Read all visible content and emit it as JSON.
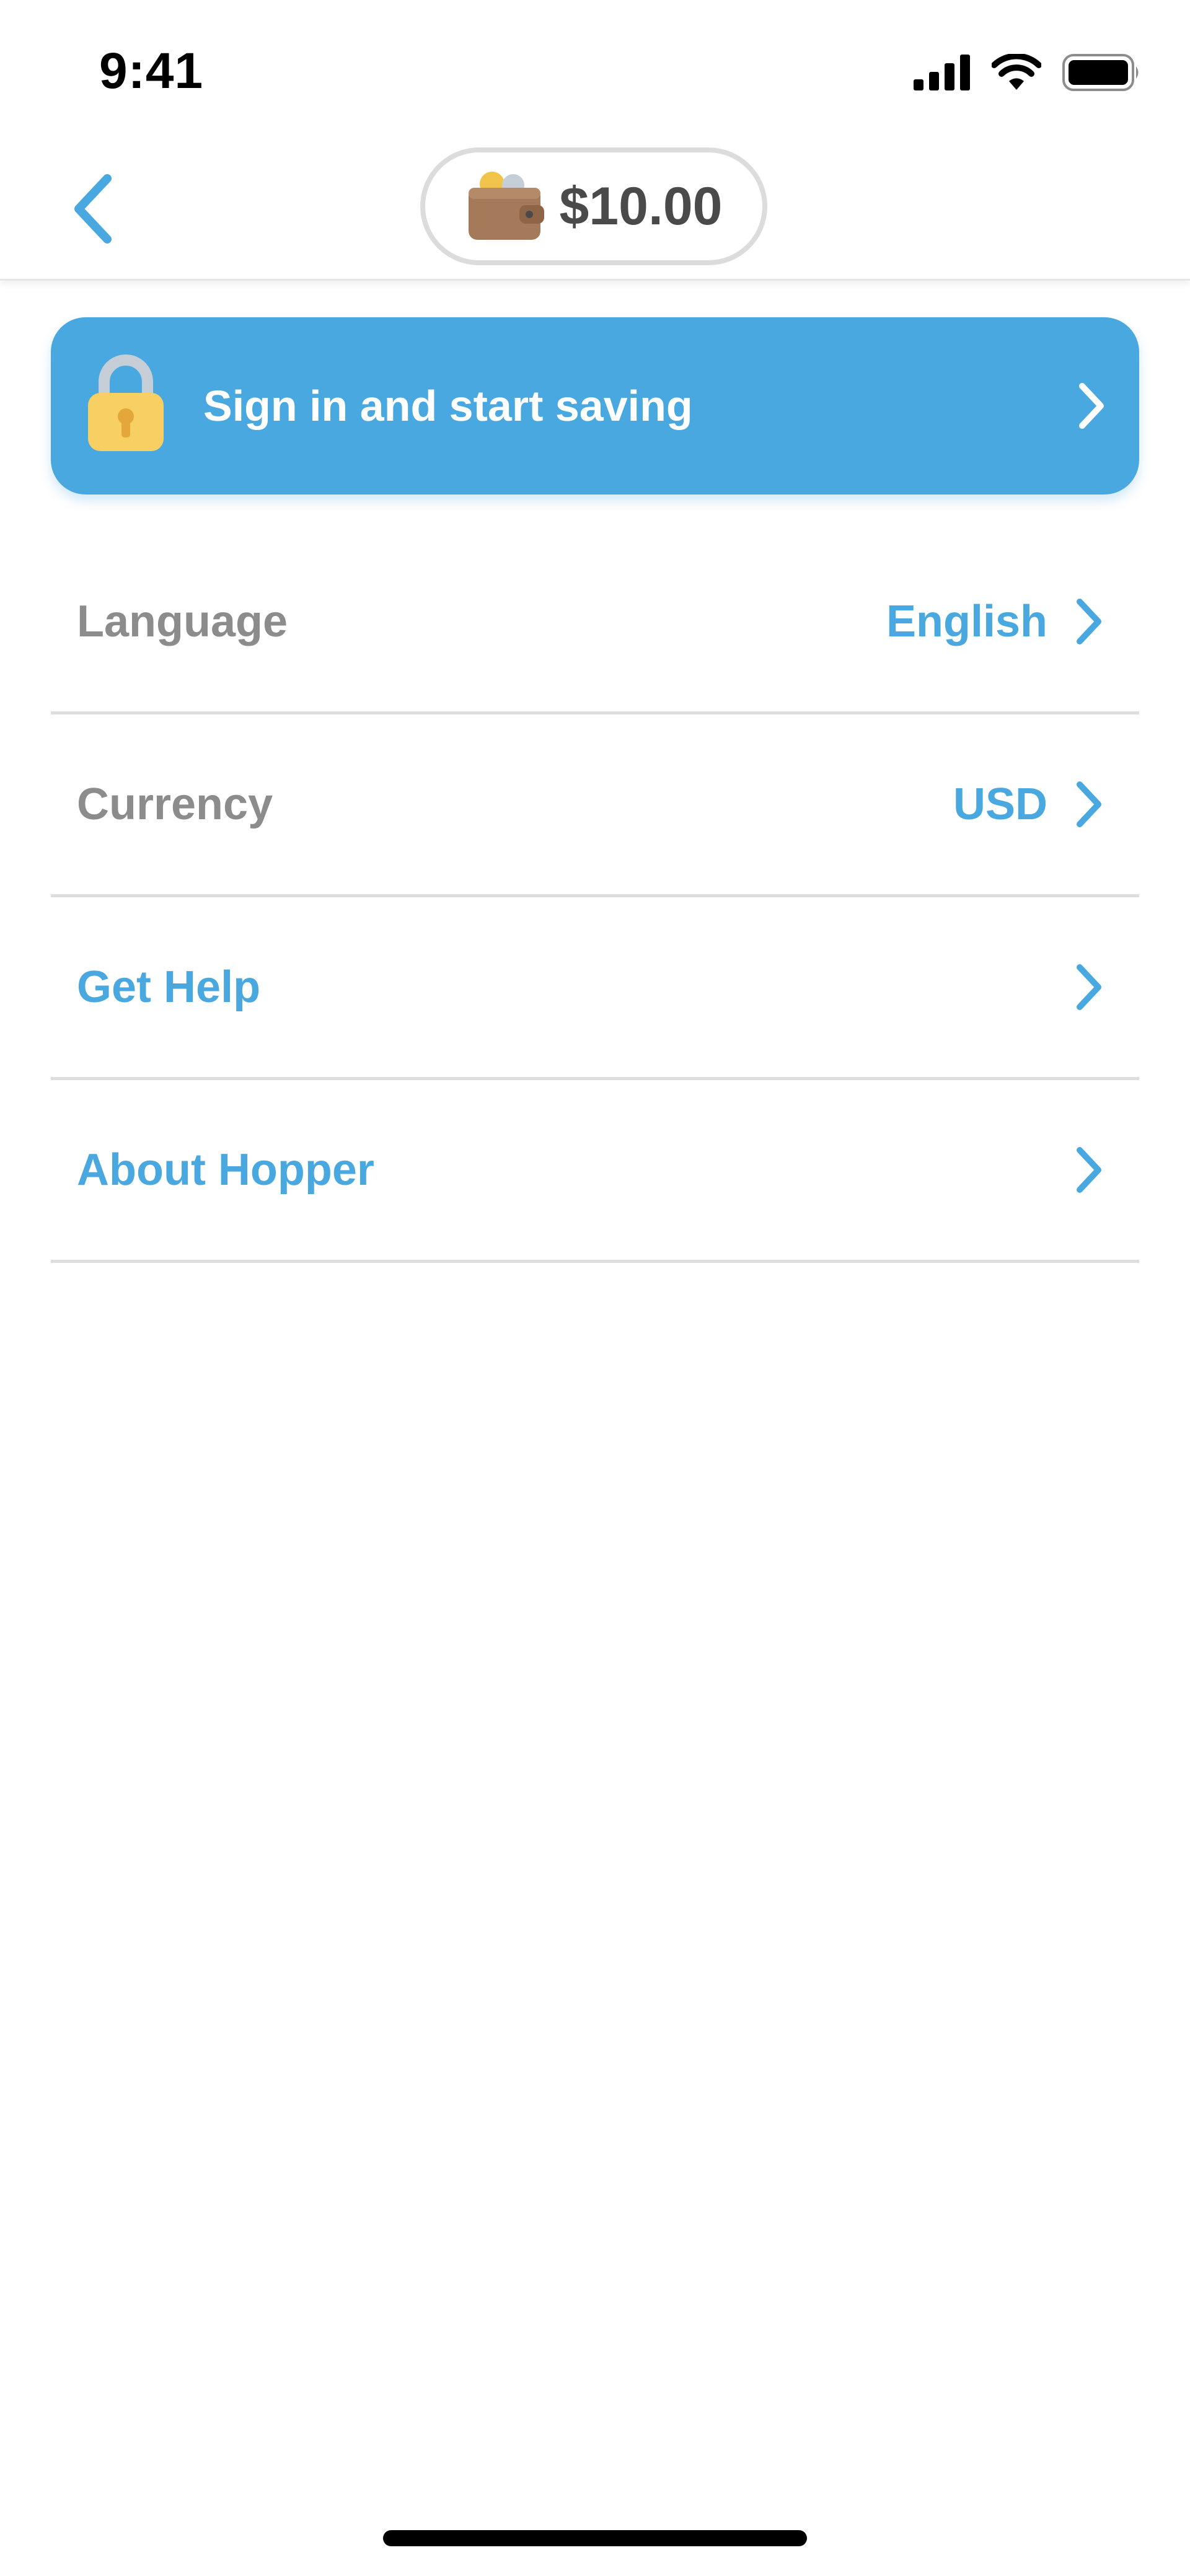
{
  "status_bar": {
    "time": "9:41",
    "icons": [
      "cellular-signal-icon",
      "wifi-icon",
      "battery-icon"
    ]
  },
  "nav": {
    "back_icon": "chevron-left-icon",
    "wallet": {
      "icon": "wallet-icon",
      "amount": "$10.00"
    }
  },
  "banner": {
    "icon": "lock-icon",
    "label": "Sign in and start saving",
    "chevron": "chevron-right-icon"
  },
  "settings": {
    "rows": [
      {
        "label": "Language",
        "value": "English"
      },
      {
        "label": "Currency",
        "value": "USD"
      },
      {
        "label": "Get Help",
        "value": ""
      },
      {
        "label": "About Hopper",
        "value": ""
      }
    ]
  },
  "colors": {
    "accent": "#4aa8e0",
    "label_gray": "#8c8c8c",
    "divider": "#dedede",
    "text_dark": "#4a4a4a"
  }
}
